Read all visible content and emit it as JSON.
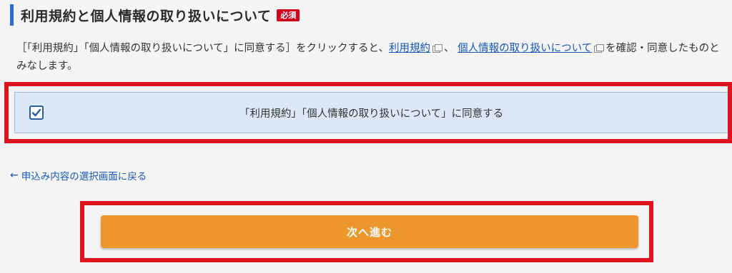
{
  "section": {
    "title": "利用規約と個人情報の取り扱いについて",
    "required_badge": "必須"
  },
  "description": {
    "part1": "［「利用規約」「個人情報の取り扱いについて」に同意する］をクリックすると、",
    "link_terms": "利用規約",
    "separator": "、",
    "link_privacy": "個人情報の取り扱いについて",
    "part2": "を確認・同意したものとみなします。"
  },
  "agreement": {
    "checked": true,
    "label": "「利用規約」「個人情報の取り扱いについて」に同意する"
  },
  "back_link": {
    "arrow": "←",
    "label": "申込み内容の選択画面に戻る"
  },
  "next_button": {
    "label": "次へ進む"
  },
  "colors": {
    "accent_blue": "#2c6cd6",
    "required_red": "#d0021b",
    "highlight_red": "#e0141e",
    "button_orange": "#ec962c",
    "agree_bg": "#dce8f7"
  }
}
